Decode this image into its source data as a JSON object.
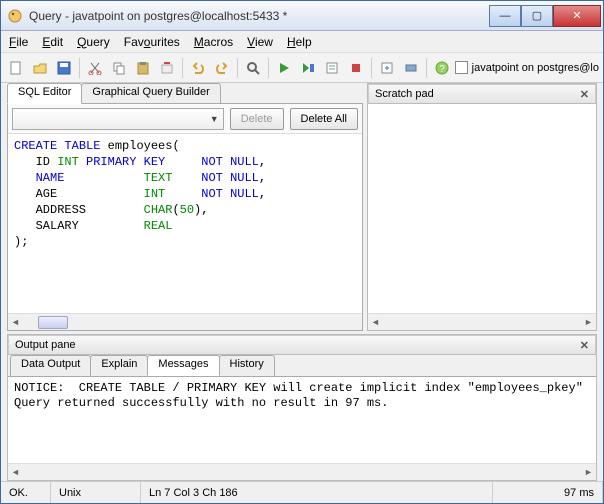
{
  "window": {
    "title": "Query - javatpoint on postgres@localhost:5433 *"
  },
  "menubar": {
    "items": [
      "File",
      "Edit",
      "Query",
      "Favourites",
      "Macros",
      "View",
      "Help"
    ]
  },
  "toolbar": {
    "connection_label": "javatpoint on postgres@lo"
  },
  "editor": {
    "tabs": {
      "sql": "SQL Editor",
      "gqb": "Graphical Query Builder"
    },
    "delete_btn": "Delete",
    "delete_all_btn": "Delete All",
    "code_tokens": [
      [
        {
          "t": "CREATE",
          "c": "kw"
        },
        {
          "t": " "
        },
        {
          "t": "TABLE",
          "c": "kw"
        },
        {
          "t": " employees("
        }
      ],
      [
        {
          "t": "   ID "
        },
        {
          "t": "INT",
          "c": "dt"
        },
        {
          "t": " "
        },
        {
          "t": "PRIMARY",
          "c": "kw"
        },
        {
          "t": " "
        },
        {
          "t": "KEY",
          "c": "kw"
        },
        {
          "t": "     "
        },
        {
          "t": "NOT",
          "c": "kw"
        },
        {
          "t": " "
        },
        {
          "t": "NULL",
          "c": "kw"
        },
        {
          "t": ","
        }
      ],
      [
        {
          "t": "   "
        },
        {
          "t": "NAME",
          "c": "kw"
        },
        {
          "t": "           "
        },
        {
          "t": "TEXT",
          "c": "dt"
        },
        {
          "t": "    "
        },
        {
          "t": "NOT",
          "c": "kw"
        },
        {
          "t": " "
        },
        {
          "t": "NULL",
          "c": "kw"
        },
        {
          "t": ","
        }
      ],
      [
        {
          "t": "   AGE            "
        },
        {
          "t": "INT",
          "c": "dt"
        },
        {
          "t": "     "
        },
        {
          "t": "NOT",
          "c": "kw"
        },
        {
          "t": " "
        },
        {
          "t": "NULL",
          "c": "kw"
        },
        {
          "t": ","
        }
      ],
      [
        {
          "t": "   ADDRESS        "
        },
        {
          "t": "CHAR",
          "c": "dt"
        },
        {
          "t": "("
        },
        {
          "t": "50",
          "c": "num"
        },
        {
          "t": "),"
        }
      ],
      [
        {
          "t": "   SALARY         "
        },
        {
          "t": "REAL",
          "c": "dt"
        }
      ],
      [
        {
          "t": ");"
        }
      ]
    ]
  },
  "scratch": {
    "title": "Scratch pad"
  },
  "output": {
    "title": "Output pane",
    "tabs": {
      "data": "Data Output",
      "explain": "Explain",
      "messages": "Messages",
      "history": "History"
    },
    "messages": "NOTICE:  CREATE TABLE / PRIMARY KEY will create implicit index \"employees_pkey\"\nQuery returned successfully with no result in 97 ms."
  },
  "status": {
    "ok": "OK.",
    "encoding": "Unix",
    "position": "Ln 7 Col 3 Ch 186",
    "time": "97 ms"
  }
}
